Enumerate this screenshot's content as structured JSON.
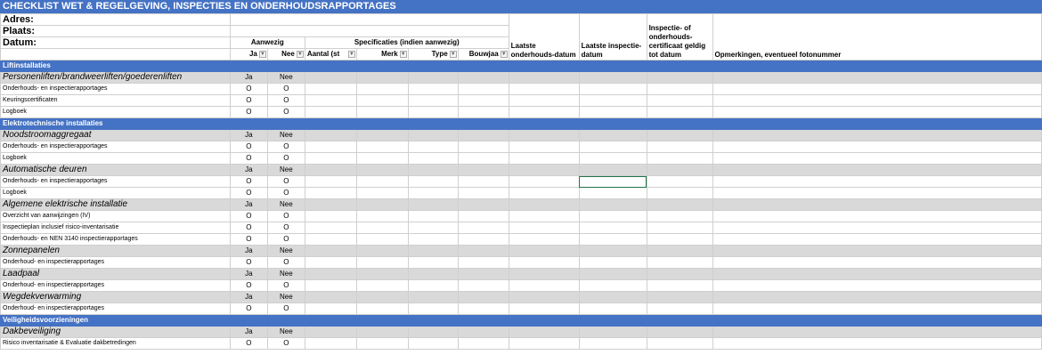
{
  "title": "CHECKLIST WET & REGELGEVING, INSPECTIES EN ONDERHOUDSRAPPORTAGES",
  "header": {
    "adres": "Adres:",
    "plaats": "Plaats:",
    "datum": "Datum:",
    "aanwezig": "Aanwezig",
    "specificaties": "Specificaties (indien aanwezig)",
    "col_ja": "Ja",
    "col_nee": "Nee",
    "col_aantal": "Aantal (st",
    "col_merk": "Merk",
    "col_type": "Type",
    "col_bouwjaar": "Bouwjaa",
    "col_onderhoud": "Laatste onderhouds-datum",
    "col_inspectie": "Laatste inspectie-datum",
    "col_certificaat": "Inspectie- of onderhouds-certificaat geldig tot datum",
    "col_opmerkingen": "Opmerkingen, eventueel fotonummer"
  },
  "rows": [
    {
      "kind": "section",
      "label": "Liftinstallaties"
    },
    {
      "kind": "group",
      "label": "Personenliften/brandweerliften/goederenliften",
      "ja": "Ja",
      "nee": "Nee"
    },
    {
      "kind": "item",
      "label": "Onderhouds- en inspectierapportages",
      "ja": "O",
      "nee": "O"
    },
    {
      "kind": "item",
      "label": "Keuringscertificaten",
      "ja": "O",
      "nee": "O"
    },
    {
      "kind": "item",
      "label": "Logboek",
      "ja": "O",
      "nee": "O"
    },
    {
      "kind": "section",
      "label": "Elektrotechnische installaties"
    },
    {
      "kind": "group",
      "label": "Noodstroomaggregaat",
      "ja": "Ja",
      "nee": "Nee"
    },
    {
      "kind": "item",
      "label": "Onderhouds- en inspectierapportages",
      "ja": "O",
      "nee": "O"
    },
    {
      "kind": "item",
      "label": "Logboek",
      "ja": "O",
      "nee": "O"
    },
    {
      "kind": "group",
      "label": "Automatische deuren",
      "ja": "Ja",
      "nee": "Nee"
    },
    {
      "kind": "item",
      "label": "Onderhouds- en inspectierapportages",
      "ja": "O",
      "nee": "O",
      "selected": true
    },
    {
      "kind": "item",
      "label": "Logboek",
      "ja": "O",
      "nee": "O"
    },
    {
      "kind": "group",
      "label": "Algemene elektrische installatie",
      "ja": "Ja",
      "nee": "Nee"
    },
    {
      "kind": "item",
      "label": "Overzicht van aanwijzingen (IV)",
      "ja": "O",
      "nee": "O"
    },
    {
      "kind": "item",
      "label": "Inspectieplan inclusief risico-inventarisatie",
      "ja": "O",
      "nee": "O"
    },
    {
      "kind": "item",
      "label": "Onderhouds- en NEN 3140 inspectierapportages",
      "ja": "O",
      "nee": "O"
    },
    {
      "kind": "group",
      "label": "Zonnepanelen",
      "ja": "Ja",
      "nee": "Nee"
    },
    {
      "kind": "item",
      "label": "Onderhoud- en inspectierapportages",
      "ja": "O",
      "nee": "O"
    },
    {
      "kind": "group",
      "label": "Laadpaal",
      "ja": "Ja",
      "nee": "Nee"
    },
    {
      "kind": "item",
      "label": "Onderhoud- en inspectierapportages",
      "ja": "O",
      "nee": "O"
    },
    {
      "kind": "group",
      "label": "Wegdekverwarming",
      "ja": "Ja",
      "nee": "Nee"
    },
    {
      "kind": "item",
      "label": "Onderhoud- en inspectierapportages",
      "ja": "O",
      "nee": "O"
    },
    {
      "kind": "section",
      "label": "Veiligheidsvoorzieningen"
    },
    {
      "kind": "group",
      "label": "Dakbeveiliging",
      "ja": "Ja",
      "nee": "Nee"
    },
    {
      "kind": "item",
      "label": "Risico inventarisatie & Evaluatie dakbetredingen",
      "ja": "O",
      "nee": "O"
    }
  ]
}
